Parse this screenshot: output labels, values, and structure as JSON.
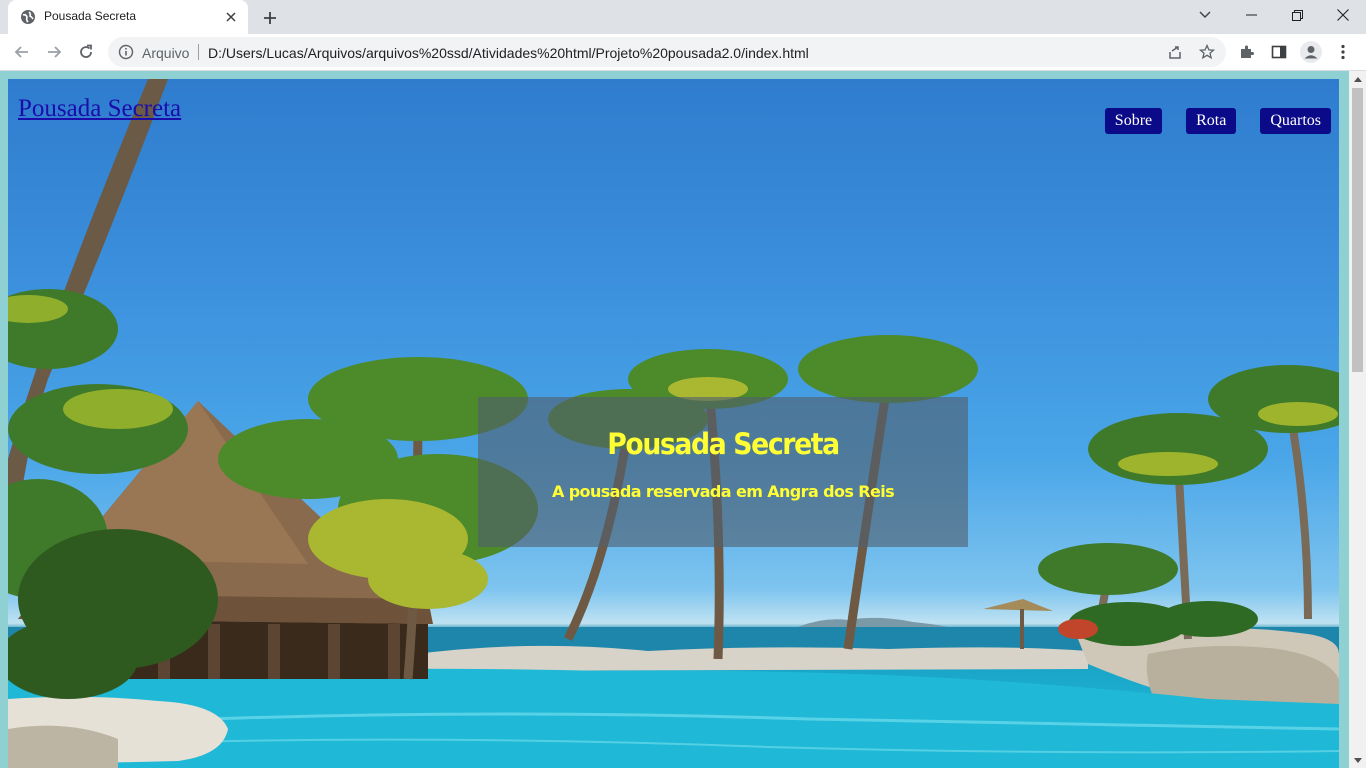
{
  "browser": {
    "tab": {
      "title": "Pousada Secreta",
      "favicon": "globe-icon",
      "close_icon": "close-icon"
    },
    "new_tab_icon": "plus-icon",
    "window_controls": [
      "chevron-down-icon",
      "minimize-icon",
      "restore-icon",
      "close-icon"
    ],
    "toolbar": {
      "back_icon": "arrow-left-icon",
      "forward_icon": "arrow-right-icon",
      "reload_icon": "reload-icon",
      "site_info_icon": "info-icon",
      "scheme_label": "Arquivo",
      "url": "D:/Users/Lucas/Arquivos/arquivos%20ssd/Atividades%20html/Projeto%20pousada2.0/index.html",
      "share_icon": "share-icon",
      "bookmark_icon": "star-icon",
      "extensions_icon": "puzzle-icon",
      "side_panel_icon": "side-panel-icon",
      "profile_icon": "avatar-icon",
      "menu_icon": "kebab-menu-icon"
    }
  },
  "page": {
    "brand": "Pousada Secreta",
    "nav": [
      {
        "label": "Sobre"
      },
      {
        "label": "Rota"
      },
      {
        "label": "Quartos"
      }
    ],
    "hero": {
      "title": "Pousada Secreta",
      "subtitle": "A pousada reservada em Angra dos Reis"
    },
    "colors": {
      "nav_button_bg": "#0b0b8a",
      "hero_text": "#ffff33",
      "page_border": "#8fd1d2",
      "brand_link": "#1a0dab"
    }
  }
}
